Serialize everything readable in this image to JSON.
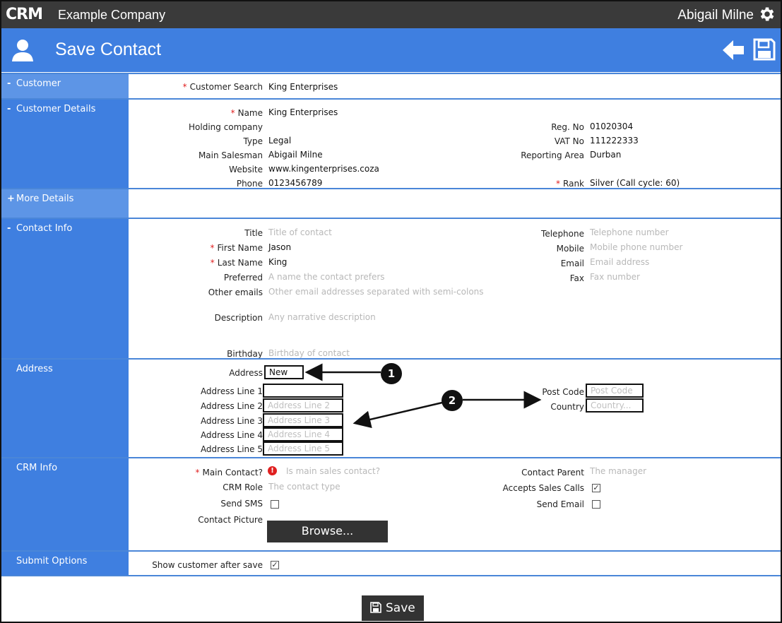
{
  "header": {
    "logo_text": "CRM",
    "company": "Example Company",
    "user": "Abigail Milne",
    "page_title": "Save Contact"
  },
  "sections": {
    "customer": "Customer",
    "customer_details": "Customer Details",
    "more_details": "More Details",
    "contact_info": "Contact Info",
    "address": "Address",
    "crm_info": "CRM Info",
    "submit_options": "Submit Options"
  },
  "toggles": {
    "minus": "-",
    "plus": "+"
  },
  "required_marker": "*",
  "customer": {
    "search_label": "Customer Search",
    "search_value": "King Enterprises"
  },
  "customer_details": {
    "name_label": "Name",
    "name": "King Enterprises",
    "holding_label": "Holding company",
    "holding": "",
    "type_label": "Type",
    "type": "Legal",
    "salesman_label": "Main Salesman",
    "salesman": "Abigail Milne",
    "website_label": "Website",
    "website": "www.kingenterprises.coza",
    "phone_label": "Phone",
    "phone": "0123456789",
    "regno_label": "Reg. No",
    "regno": "01020304",
    "vatno_label": "VAT No",
    "vatno": "111222333",
    "area_label": "Reporting Area",
    "area": "Durban",
    "rank_label": "Rank",
    "rank": "Silver (Call cycle: 60)"
  },
  "contact_info": {
    "title_label": "Title",
    "title_ph": "Title of contact",
    "first_label": "First Name",
    "first": "Jason",
    "last_label": "Last Name",
    "last": "King",
    "preferred_label": "Preferred",
    "preferred_ph": "A name the contact prefers",
    "other_emails_label": "Other emails",
    "other_emails_ph": "Other email addresses separated with semi-colons",
    "description_label": "Description",
    "description_ph": "Any narrative description",
    "birthday_label": "Birthday",
    "birthday_ph": "Birthday of contact",
    "telephone_label": "Telephone",
    "telephone_ph": "Telephone number",
    "mobile_label": "Mobile",
    "mobile_ph": "Mobile phone number",
    "email_label": "Email",
    "email_ph": "Email address",
    "fax_label": "Fax",
    "fax_ph": "Fax number"
  },
  "address": {
    "address_label": "Address",
    "address_value": "New",
    "line1_label": "Address Line 1",
    "line1_ph": "",
    "line2_label": "Address Line 2",
    "line2_ph": "Address Line 2",
    "line3_label": "Address Line 3",
    "line3_ph": "Address Line 3",
    "line4_label": "Address Line 4",
    "line4_ph": "Address Line 4",
    "line5_label": "Address Line 5",
    "line5_ph": "Address Line 5",
    "postcode_label": "Post Code",
    "postcode_ph": "Post Code",
    "country_label": "Country",
    "country_ph": "Country...",
    "callout1": "1",
    "callout2": "2"
  },
  "crm_info": {
    "main_contact_label": "Main Contact?",
    "main_contact_ph": "Is main sales contact?",
    "alert_glyph": "!",
    "role_label": "CRM Role",
    "role_ph": "The contact type",
    "sms_label": "Send SMS",
    "sms_checked": false,
    "picture_label": "Contact Picture",
    "browse_label": "Browse...",
    "parent_label": "Contact Parent",
    "parent_ph": "The manager",
    "accepts_label": "Accepts Sales Calls",
    "accepts_checked": true,
    "send_email_label": "Send Email",
    "send_email_checked": false
  },
  "submit_options": {
    "show_label": "Show customer after save",
    "show_checked": true
  },
  "footer": {
    "save_label": "Save"
  },
  "colors": {
    "accent": "#3f7fe0",
    "topbar": "#3a3a3a",
    "required": "#e02020"
  },
  "icons": [
    "gear-icon",
    "person-icon",
    "back-arrow-icon",
    "save-icon",
    "alert-icon"
  ]
}
